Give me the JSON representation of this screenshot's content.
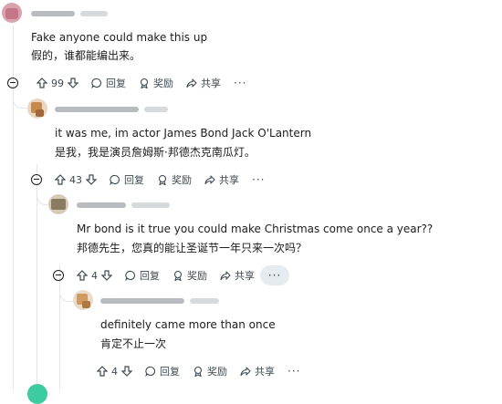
{
  "comments": [
    {
      "id": "c1",
      "text_en": "Fake anyone could make this up",
      "text_zh": "假的，谁都能编出来。",
      "votes": "99",
      "reply_label": "回复",
      "award_label": "奖励",
      "share_label": "共享",
      "more_label": "···"
    },
    {
      "id": "c2",
      "text_en": "it was me, im actor James Bond Jack O'Lantern",
      "text_zh": "是我，我是演员詹姆斯·邦德杰克南瓜灯。",
      "votes": "43",
      "reply_label": "回复",
      "award_label": "奖励",
      "share_label": "共享",
      "more_label": "···"
    },
    {
      "id": "c3",
      "text_en": "Mr bond is it true you could make Christmas come once a year??",
      "text_zh": "邦德先生，您真的能让圣诞节一年只来一次吗？",
      "votes": "4",
      "reply_label": "回复",
      "award_label": "奖励",
      "share_label": "共享",
      "more_label": "···"
    },
    {
      "id": "c4",
      "text_en": "definitely came more than once",
      "text_zh": "肯定不止一次",
      "votes": "4",
      "reply_label": "回复",
      "award_label": "奖励",
      "share_label": "共享",
      "more_label": "···"
    }
  ],
  "colors": {
    "thread": "#e3e6e8",
    "text": "#1c1c1c",
    "muted": "#3e4a52",
    "pill": "#e5ebee"
  },
  "icons": [
    "collapse-icon",
    "upvote-icon",
    "downvote-icon",
    "reply-icon",
    "award-icon",
    "share-icon",
    "more-icon"
  ]
}
